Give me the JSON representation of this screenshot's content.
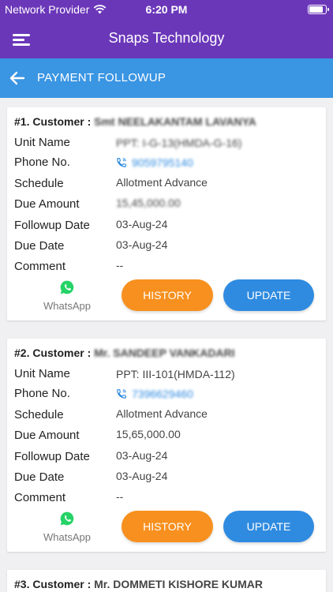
{
  "status_bar": {
    "carrier": "Network Provider",
    "time": "6:20 PM"
  },
  "app_bar": {
    "title": "Snaps Technology"
  },
  "sub_bar": {
    "title": "PAYMENT FOLLOWUP"
  },
  "labels": {
    "unit_name": "Unit Name",
    "phone": "Phone No.",
    "schedule": "Schedule",
    "due_amount": "Due Amount",
    "followup_date": "Followup Date",
    "due_date": "Due Date",
    "comment": "Comment",
    "whatsapp": "WhatsApp",
    "history": "HISTORY",
    "update": "UPDATE"
  },
  "customers": [
    {
      "prefix": "#1. Customer : ",
      "name": "Smt NEELAKANTAM LAVANYA",
      "unit_name": "PPT: I-G-13(HMDA-G-16)",
      "phone": "9059795140",
      "schedule": "Allotment Advance",
      "due_amount": "15,45,000.00",
      "followup_date": "03-Aug-24",
      "due_date": "03-Aug-24",
      "comment": "--"
    },
    {
      "prefix": "#2. Customer : ",
      "name": "Mr. SANDEEP VANKADARI",
      "unit_name": "PPT: III-101(HMDA-112)",
      "phone": "7396629460",
      "schedule": "Allotment Advance",
      "due_amount": "15,65,000.00",
      "followup_date": "03-Aug-24",
      "due_date": "03-Aug-24",
      "comment": "--"
    },
    {
      "prefix": "#3. Customer : ",
      "name": "Mr. DOMMETI KISHORE KUMAR"
    }
  ],
  "colors": {
    "header_purple": "#6b37b9",
    "subbar_blue": "#3a95e3",
    "history_orange": "#f7901e",
    "update_blue": "#2f8be0",
    "whatsapp_green": "#25d366"
  }
}
